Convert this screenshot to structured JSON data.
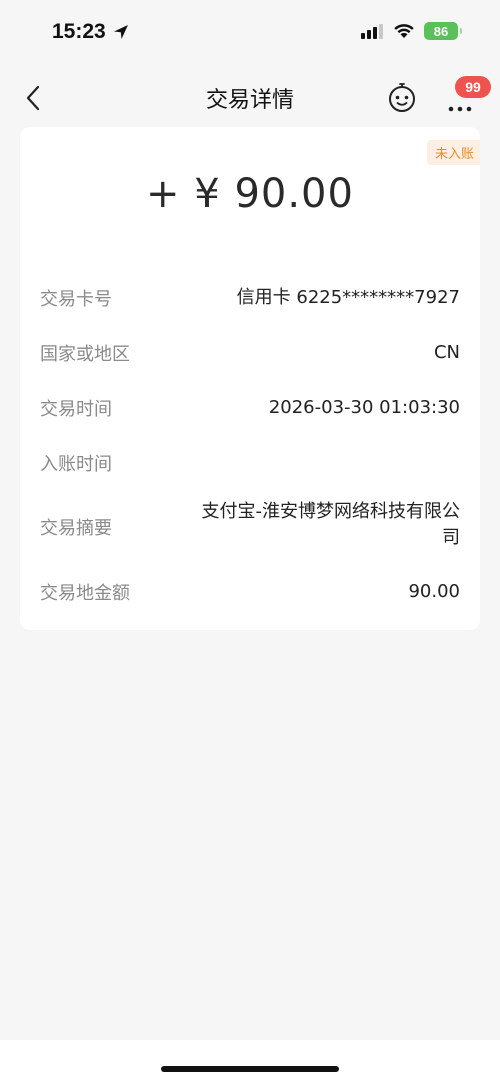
{
  "status_bar": {
    "time": "15:23",
    "battery": "86"
  },
  "nav": {
    "title": "交易详情",
    "badge": "99"
  },
  "transaction": {
    "status_tag": "未入账",
    "amount": "+ ¥ 90.00",
    "rows": [
      {
        "label": "交易卡号",
        "value": "信用卡 6225********7927"
      },
      {
        "label": "国家或地区",
        "value": "CN"
      },
      {
        "label": "交易时间",
        "value": "2026-03-30 01:03:30"
      },
      {
        "label": "入账时间",
        "value": ""
      },
      {
        "label": "交易摘要",
        "value": "支付宝-淮安博梦网络科技有限公司"
      },
      {
        "label": "交易地金额",
        "value": "90.00"
      }
    ]
  },
  "colors": {
    "background": "#f6f6f6",
    "badge": "#ef5350",
    "status_tag_text": "#ec8b2c",
    "battery": "#5ac05a"
  }
}
